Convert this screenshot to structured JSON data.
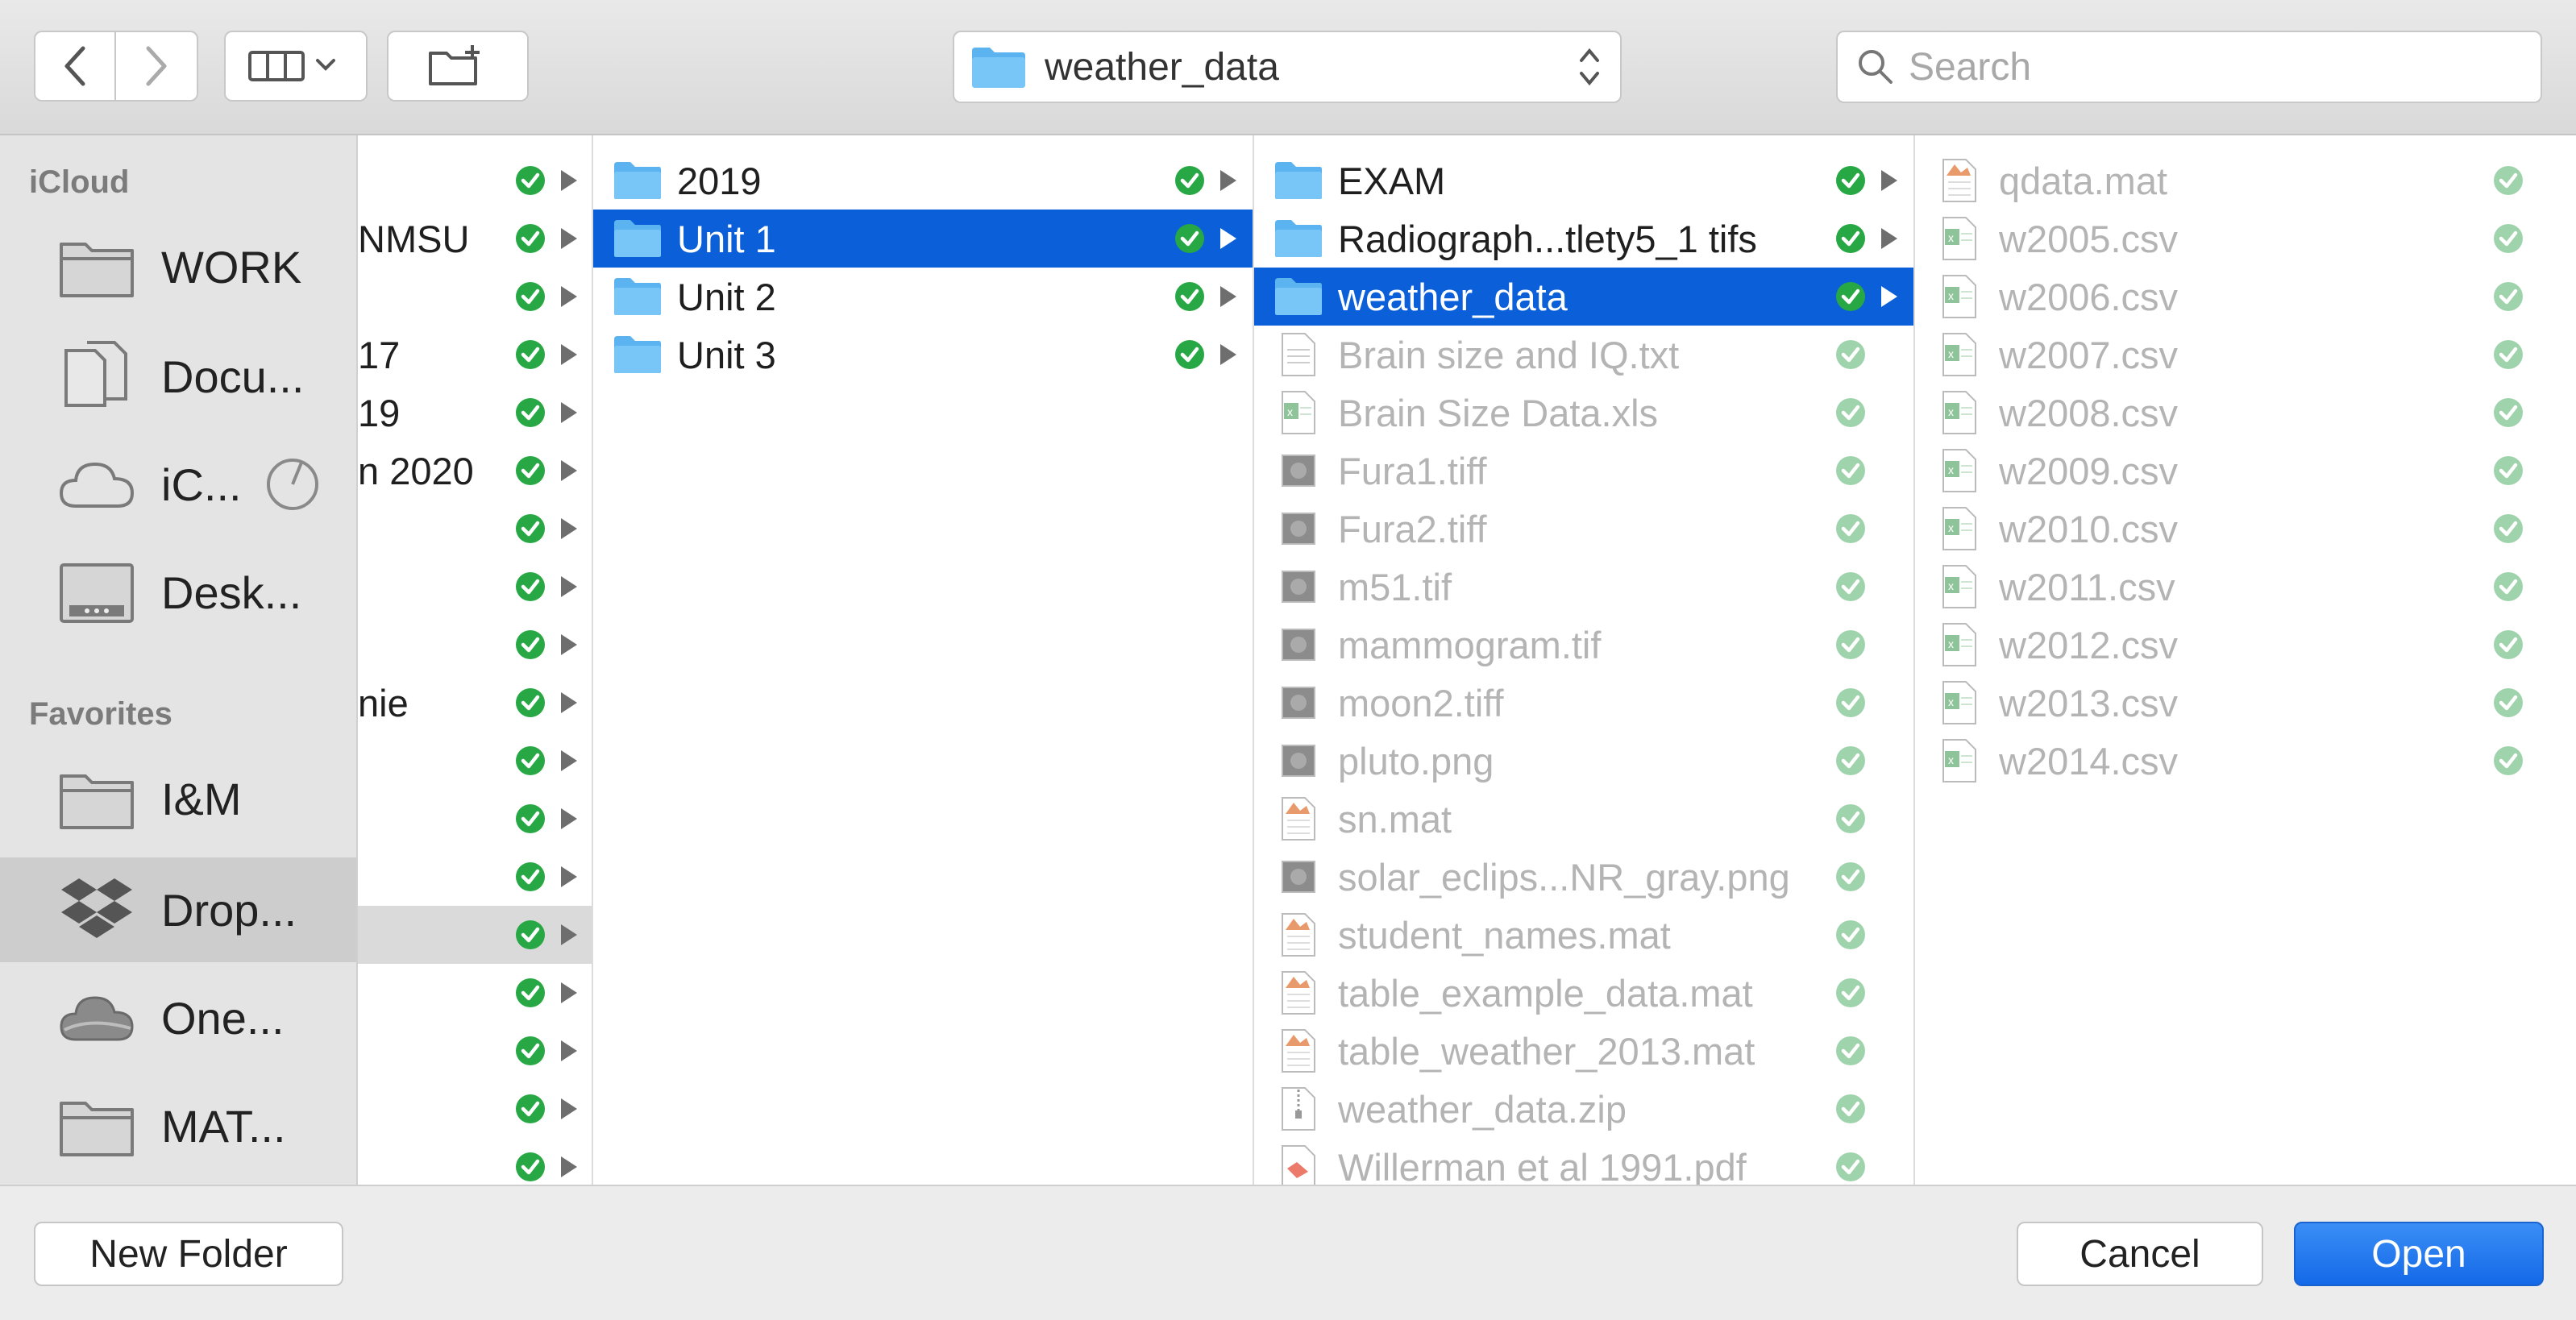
{
  "toolbar": {
    "back_icon": "chevron-left-icon",
    "forward_icon": "chevron-right-icon",
    "view_icon": "column-view-icon",
    "new_folder_icon": "new-folder-icon",
    "path_label": "weather_data",
    "search_placeholder": "Search"
  },
  "sidebar": {
    "icloud_header": "iCloud",
    "icloud_items": [
      {
        "label": "WORK",
        "icon": "folder-icon"
      },
      {
        "label": "Docu...",
        "icon": "documents-icon"
      },
      {
        "label": "iC...",
        "icon": "icloud-drive-icon"
      },
      {
        "label": "Desk...",
        "icon": "desktop-icon"
      }
    ],
    "favorites_header": "Favorites",
    "favorites_items": [
      {
        "label": "I&M",
        "icon": "folder-icon"
      },
      {
        "label": "Drop...",
        "icon": "dropbox-icon"
      },
      {
        "label": "One...",
        "icon": "onedrive-icon"
      },
      {
        "label": "MAT...",
        "icon": "folder-icon"
      }
    ]
  },
  "columns": {
    "col1": [
      "",
      "NMSU",
      "",
      "17",
      "19",
      "n 2020",
      "",
      "",
      "",
      "nie",
      "",
      "",
      "",
      "",
      "",
      "",
      "",
      ""
    ],
    "col2": [
      "2019",
      "Unit 1",
      "Unit 2",
      "Unit 3"
    ],
    "col3": [
      {
        "name": "EXAM",
        "type": "folder"
      },
      {
        "name": "Radiograph...tlety5_1 tifs",
        "type": "folder"
      },
      {
        "name": "weather_data",
        "type": "folder"
      },
      {
        "name": "Brain size and IQ.txt",
        "type": "txt"
      },
      {
        "name": "Brain Size Data.xls",
        "type": "xls"
      },
      {
        "name": "Fura1.tiff",
        "type": "img"
      },
      {
        "name": "Fura2.tiff",
        "type": "img"
      },
      {
        "name": "m51.tif",
        "type": "img"
      },
      {
        "name": "mammogram.tif",
        "type": "img"
      },
      {
        "name": "moon2.tiff",
        "type": "img"
      },
      {
        "name": "pluto.png",
        "type": "img"
      },
      {
        "name": "sn.mat",
        "type": "mat"
      },
      {
        "name": "solar_eclips...NR_gray.png",
        "type": "img"
      },
      {
        "name": "student_names.mat",
        "type": "mat"
      },
      {
        "name": "table_example_data.mat",
        "type": "mat"
      },
      {
        "name": "table_weather_2013.mat",
        "type": "mat"
      },
      {
        "name": "weather_data.zip",
        "type": "zip"
      },
      {
        "name": "Willerman et al 1991.pdf",
        "type": "pdf"
      }
    ],
    "col4": [
      {
        "name": "qdata.mat",
        "type": "mat"
      },
      {
        "name": "w2005.csv",
        "type": "csv"
      },
      {
        "name": "w2006.csv",
        "type": "csv"
      },
      {
        "name": "w2007.csv",
        "type": "csv"
      },
      {
        "name": "w2008.csv",
        "type": "csv"
      },
      {
        "name": "w2009.csv",
        "type": "csv"
      },
      {
        "name": "w2010.csv",
        "type": "csv"
      },
      {
        "name": "w2011.csv",
        "type": "csv"
      },
      {
        "name": "w2012.csv",
        "type": "csv"
      },
      {
        "name": "w2013.csv",
        "type": "csv"
      },
      {
        "name": "w2014.csv",
        "type": "csv"
      }
    ]
  },
  "bottom": {
    "new_folder_label": "New Folder",
    "cancel_label": "Cancel",
    "open_label": "Open"
  },
  "colors": {
    "selection": "#0b5fd9",
    "sync_green": "#27a844",
    "folder_blue": "#6ec1f5"
  }
}
